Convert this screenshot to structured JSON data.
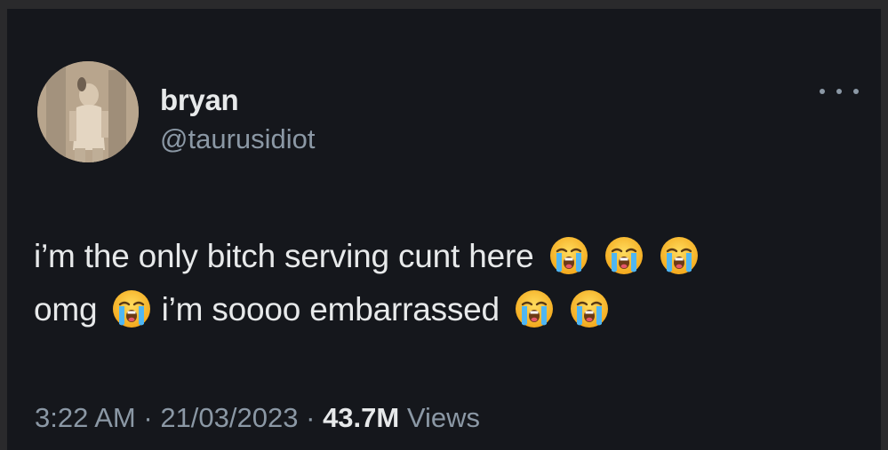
{
  "author": {
    "name": "bryan",
    "handle": "@taurusidiot"
  },
  "tweet": {
    "line1_text": "i’m the only bitch serving cunt here",
    "line2_text_a": "omg",
    "line2_text_b": "i’m soooo embarrassed",
    "emoji_name": "loudly-crying-face"
  },
  "meta": {
    "time": "3:22 AM",
    "separator": "·",
    "date": "21/03/2023",
    "views_count": "43.7M",
    "views_label": "Views"
  },
  "icons": {
    "more": "more-horizontal-icon",
    "avatar": "profile-photo"
  },
  "colors": {
    "background": "#15171c",
    "primary_text": "#e7e9ea",
    "secondary_text": "#8b98a5"
  }
}
